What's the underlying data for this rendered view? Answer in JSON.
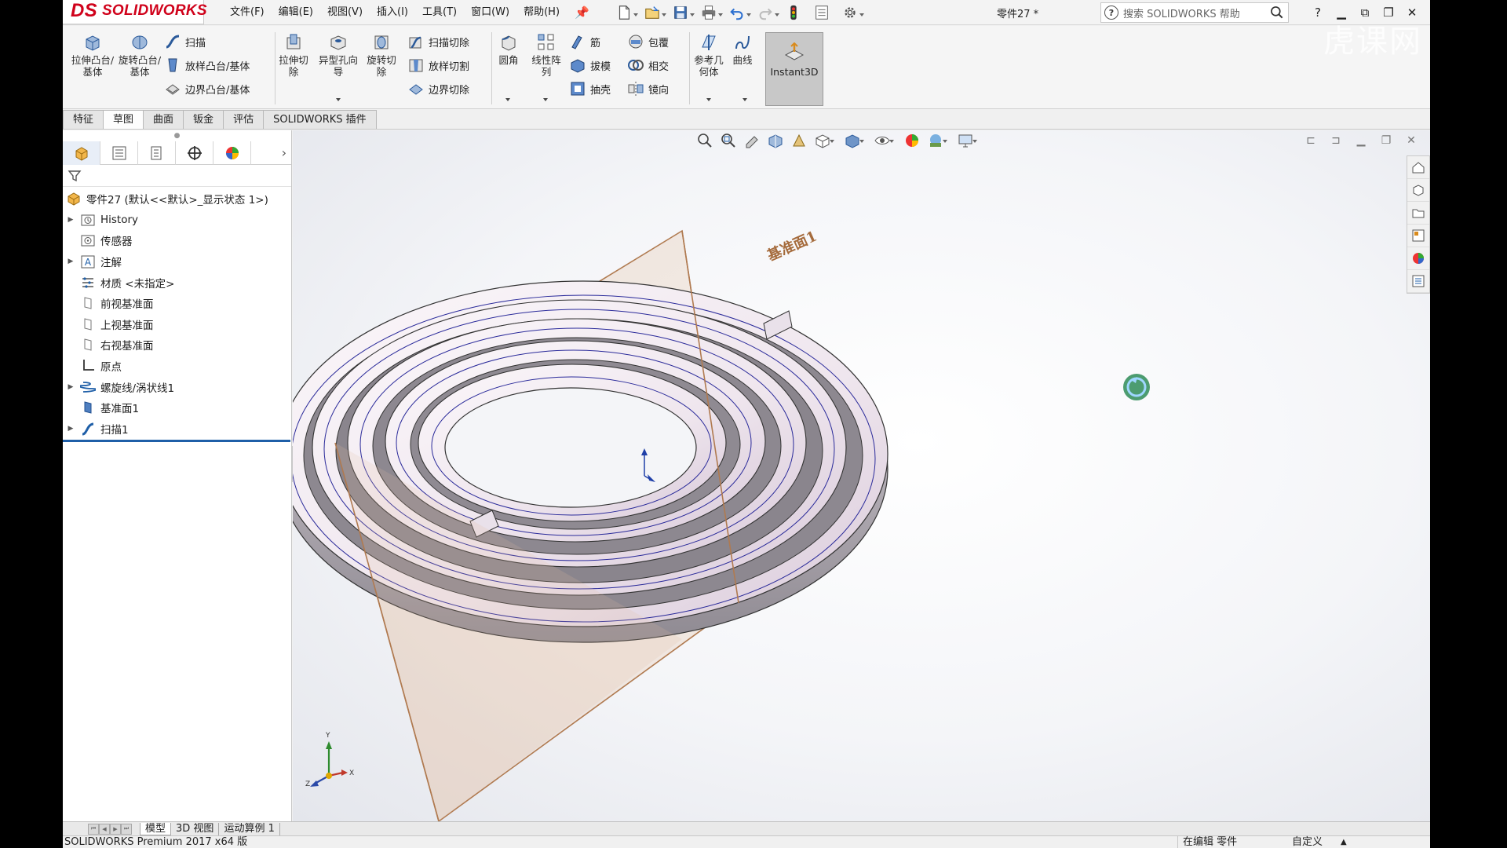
{
  "app": {
    "logo_ds": "DS",
    "logo_text": "SOLIDWORKS",
    "document_title": "零件27 *",
    "search_placeholder": "搜索 SOLIDWORKS 帮助"
  },
  "menus": [
    "文件(F)",
    "编辑(E)",
    "视图(V)",
    "插入(I)",
    "工具(T)",
    "窗口(W)",
    "帮助(H)"
  ],
  "ribbon": {
    "extrude_boss": "拉伸凸台/基体",
    "revolve_boss": "旋转凸台/基体",
    "sweep": "扫描",
    "loft_boss": "放样凸台/基体",
    "boundary_boss": "边界凸台/基体",
    "extrude_cut": "拉伸切除",
    "hole_wizard": "异型孔向导",
    "revolve_cut": "旋转切除",
    "sweep_cut": "扫描切除",
    "loft_cut": "放样切割",
    "boundary_cut": "边界切除",
    "fillet": "圆角",
    "linear_pattern": "线性阵列",
    "rib": "筋",
    "draft": "拔模",
    "shell": "抽壳",
    "wrap": "包覆",
    "intersect": "相交",
    "mirror": "镜向",
    "ref_geometry": "参考几何体",
    "curves": "曲线",
    "instant3d": "Instant3D"
  },
  "cm_tabs": [
    "特征",
    "草图",
    "曲面",
    "钣金",
    "评估",
    "SOLIDWORKS 插件"
  ],
  "tree": {
    "root": "零件27 (默认<<默认>_显示状态 1>)",
    "items": [
      {
        "label": "History",
        "expandable": true
      },
      {
        "label": "传感器",
        "expandable": false
      },
      {
        "label": "注解",
        "expandable": true
      },
      {
        "label": "材质 <未指定>",
        "expandable": false
      },
      {
        "label": "前视基准面",
        "expandable": false
      },
      {
        "label": "上视基准面",
        "expandable": false
      },
      {
        "label": "右视基准面",
        "expandable": false
      },
      {
        "label": "原点",
        "expandable": false
      },
      {
        "label": "螺旋线/涡状线1",
        "expandable": true
      },
      {
        "label": "基准面1",
        "expandable": false
      },
      {
        "label": "扫描1",
        "expandable": true
      }
    ]
  },
  "viewport": {
    "plane_label": "基准面1",
    "triad_x": "X",
    "triad_y": "Y",
    "triad_z": "Z"
  },
  "bottom_tabs": [
    "模型",
    "3D 视图",
    "运动算例 1"
  ],
  "status": {
    "version": "SOLIDWORKS Premium 2017 x64 版",
    "editing": "在编辑 零件",
    "units": "自定义"
  },
  "watermark": "虎课网",
  "colors": {
    "brand_red": "#d0021b",
    "selection_blue": "#1f5fa8",
    "plane_orange": "#b07a50"
  }
}
